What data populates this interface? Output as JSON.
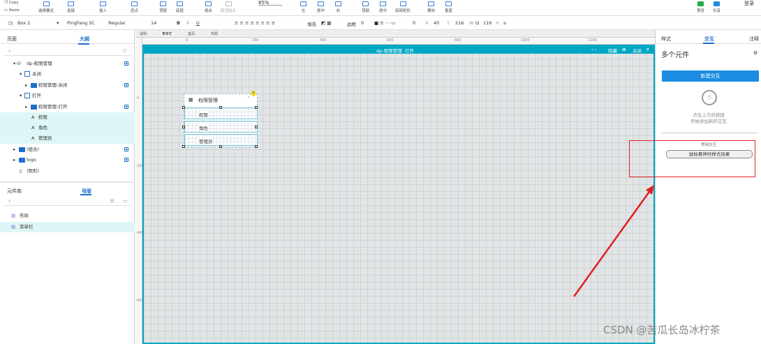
{
  "toolbar": {
    "copy": "Copy",
    "paste": "Paste",
    "select_mode": "选择模式",
    "connect": "连接",
    "insert": "插入",
    "points": "控点",
    "top": "顶层",
    "bottom": "底层",
    "group": "组合",
    "ungroup": "取消组合",
    "zoom": "85%",
    "left": "左",
    "center": "居中",
    "right": "右",
    "top_align": "顶部",
    "middle": "居中",
    "bottom_align": "底部矩形",
    "horizontal": "横向",
    "vertical": "垂直",
    "preview": "预览",
    "share": "共享",
    "login": "登录"
  },
  "format": {
    "widget": "Box 2",
    "font": "PingFang SC",
    "style": "Regular",
    "size": "14",
    "fill": "填充",
    "border": "边框",
    "border_value": "0",
    "x": "0",
    "x_label": "X",
    "y": "40",
    "y_label": "Y",
    "w": "216",
    "w_label": "W",
    "h": "116",
    "h_label": "H"
  },
  "left": {
    "tab_pages": "页面",
    "tab_outline": "大纲",
    "tree": [
      {
        "label": "dp-权限管理"
      },
      {
        "label": "关闭"
      },
      {
        "label": "权限管理-关闭"
      },
      {
        "label": "打开"
      },
      {
        "label": "权限管理-打开"
      },
      {
        "label": "权限"
      },
      {
        "label": "角色"
      },
      {
        "label": "管理员"
      },
      {
        "label": "(组合)"
      },
      {
        "label": "logo"
      },
      {
        "label": "(矩形)"
      }
    ],
    "tab_library": "元件库",
    "tab_masters": "母版",
    "masters": [
      {
        "label": "布局"
      },
      {
        "label": "菜单栏"
      }
    ]
  },
  "tabs": [
    "说明",
    "菜单栏",
    "首页",
    "布局"
  ],
  "ruler": {
    "top": [
      "0",
      "200",
      "400",
      "600",
      "800",
      "1000",
      "1200"
    ],
    "left": [
      "0",
      "200",
      "400",
      "600"
    ]
  },
  "canvas_bar": {
    "title": "dp-权限管理: 打开",
    "hide": "隐藏",
    "close": "关闭"
  },
  "menu": {
    "header": "权限管理",
    "items": [
      "权限",
      "角色",
      "管理员"
    ]
  },
  "right": {
    "tab_style": "样式",
    "tab_interact": "交互",
    "tab_notes": "注释",
    "title": "多个元件",
    "new_interaction": "新建交互",
    "hint1": "点击上方的按钮",
    "hint2": "开始添加新的交互",
    "common": "常用交互",
    "hover_btn": "鼠标悬停时样式效果"
  },
  "watermark": "CSDN @苦瓜长岛冰柠茶",
  "colors": {
    "accent": "#00a7c4",
    "blue": "#1c8ce3",
    "red": "#e02020"
  }
}
